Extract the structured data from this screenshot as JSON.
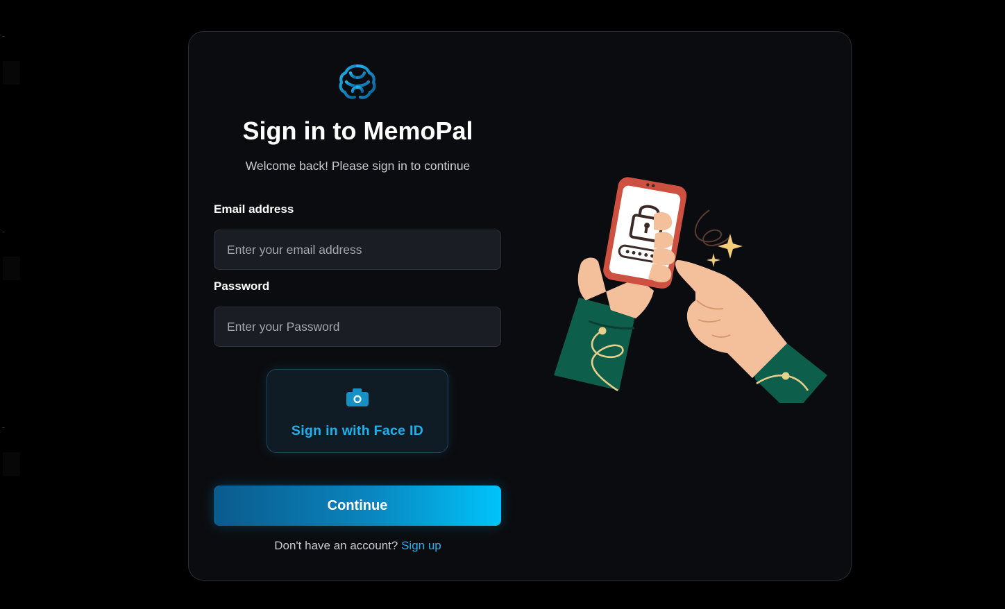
{
  "app_name": "MemoPal",
  "header": {
    "title": "Sign in to MemoPal",
    "subtitle": "Welcome back! Please sign in to continue"
  },
  "form": {
    "email": {
      "label": "Email address",
      "placeholder": "Enter your email address",
      "value": ""
    },
    "password": {
      "label": "Password",
      "placeholder": "Enter your Password",
      "value": ""
    },
    "face_id": {
      "label": "Sign in with Face ID",
      "icon": "camera-icon"
    },
    "continue_label": "Continue"
  },
  "footer": {
    "prompt": "Don't have an account?",
    "link_label": "Sign up"
  },
  "icons": {
    "logo": "brain-logo-icon",
    "illustration": "phone-lock-illustration"
  },
  "colors": {
    "background": "#000000",
    "card": "#0b0c0f",
    "input_bg": "#1a1d23",
    "accent": "#19b3ef",
    "button_gradient_start": "#0b5a8c",
    "button_gradient_end": "#00c4fa"
  }
}
